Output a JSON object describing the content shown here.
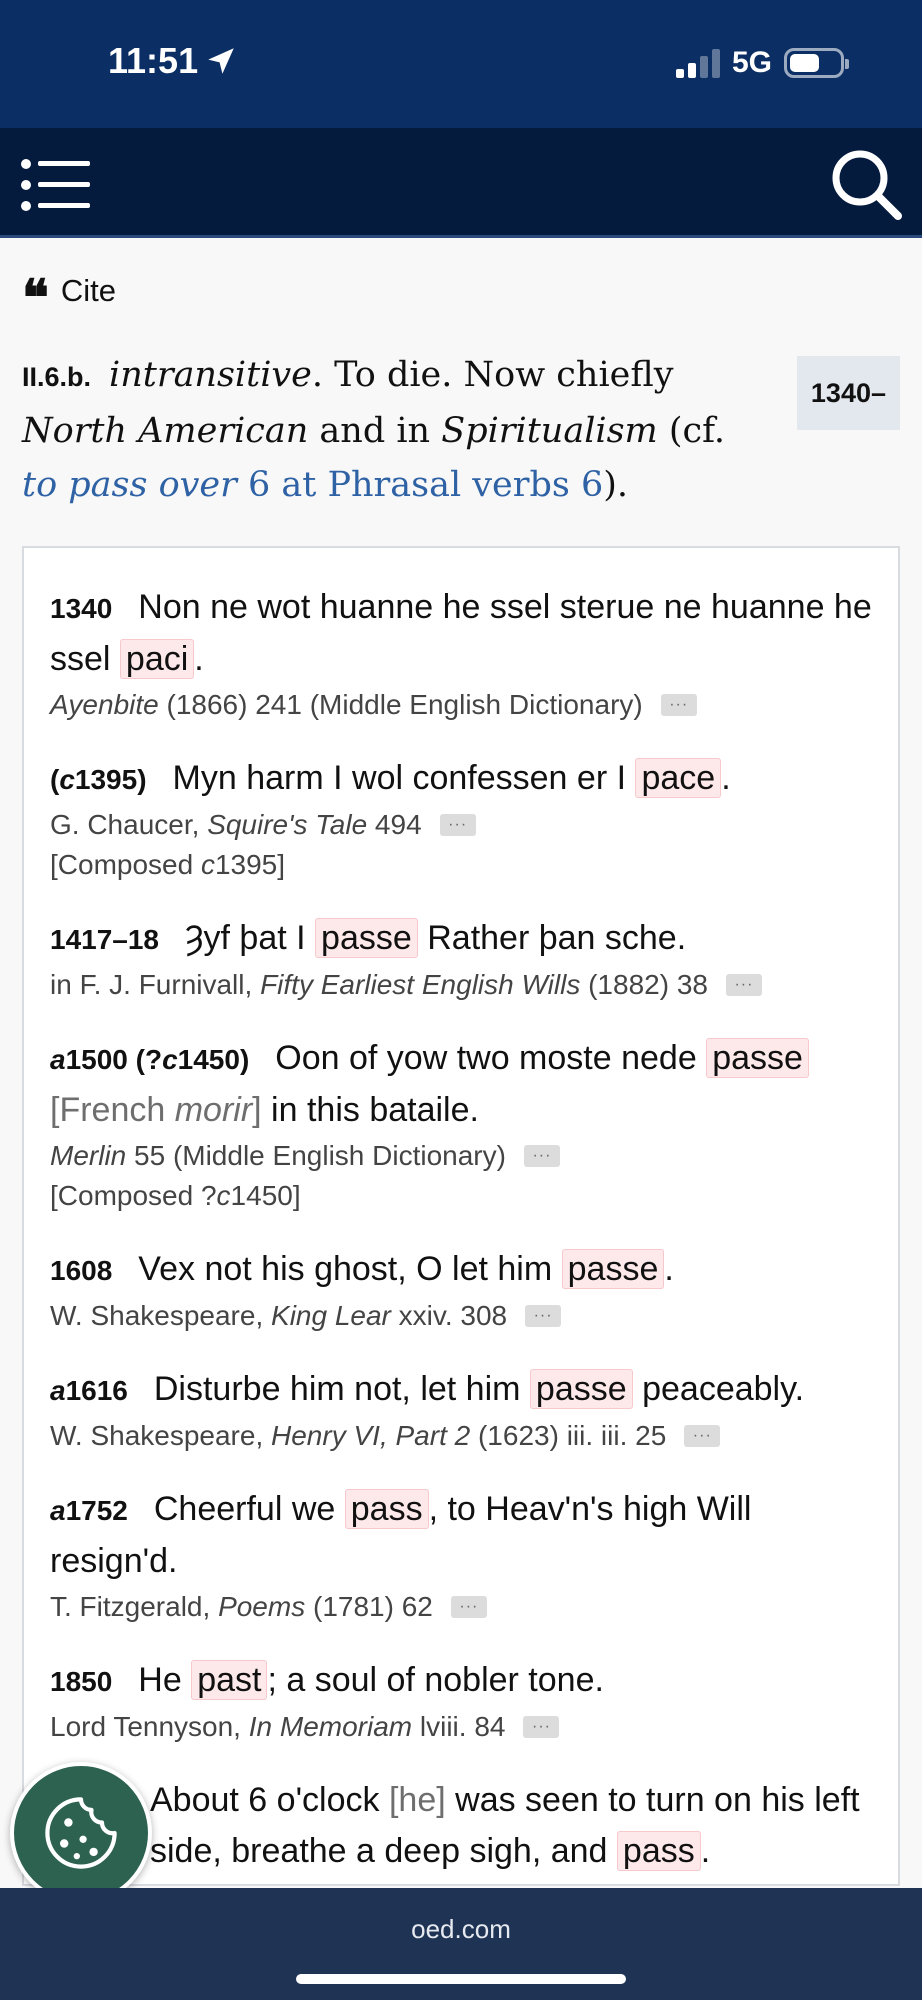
{
  "status_bar": {
    "time": "11:51",
    "network": "5G",
    "battery_level": 0.6
  },
  "header": {
    "menu_icon": "hamburger-menu-icon",
    "search_icon": "search-icon"
  },
  "cite": {
    "label": "Cite"
  },
  "sense": {
    "number": "II.6.b.",
    "p1": "intransitive",
    "p2": ". To die. Now chiefly",
    "p3": "North American",
    "p4": " and in ",
    "p5": "Spiritualism",
    "p6": " (cf. ",
    "link1": "to pass over",
    "link2": " 6 at Phrasal verbs 6",
    "p7": ").",
    "date_range": "1340–"
  },
  "quotations": [
    {
      "year": "1340",
      "pre": "Non ne wot huanne he ssel sterue ne huanne he ssel ",
      "hl": "paci",
      "post": ".",
      "src_italic": "Ayenbite",
      "src_after": " (1866) 241 (Middle English Dictionary)"
    },
    {
      "year_a": "(",
      "year_i": "c",
      "year_b": "1395)",
      "pre": "Myn harm I wol confessen er I ",
      "hl": "pace",
      "post": ".",
      "src_before": "G. Chaucer, ",
      "src_italic": "Squire's Tale",
      "src_after": " 494",
      "note_a": "[Composed ",
      "note_i": "c",
      "note_b": "1395]"
    },
    {
      "year": "1417–18",
      "pre": "Ȝyf þat I ",
      "hl": "passe",
      "post": " Rather þan sche.",
      "src_before": "in F. J. Furnivall, ",
      "src_italic": "Fifty Earliest English Wills",
      "src_after": " (1882) 38"
    },
    {
      "year_i": "a",
      "year_b": "1500 (?",
      "year_i2": "c",
      "year_c": "1450)",
      "pre": "Oon of yow two moste nede ",
      "hl": "passe",
      "br_a": "[French ",
      "br_i": "morir",
      "br_b": "]",
      "post": " in this bataile.",
      "src_italic": "Merlin",
      "src_after": " 55 (Middle English Dictionary)",
      "note_a": "[Composed ?",
      "note_i": "c",
      "note_b": "1450]"
    },
    {
      "year": "1608",
      "pre": "Vex not his ghost, O let him ",
      "hl": "passe",
      "post": ".",
      "src_before": "W. Shakespeare, ",
      "src_italic": "King Lear",
      "src_after": " xxiv. 308"
    },
    {
      "year_i": "a",
      "year_b": "1616",
      "pre": "Disturbe him not, let him ",
      "hl": "passe",
      "post": " peaceably.",
      "src_before": "W. Shakespeare, ",
      "src_italic": "Henry VI, Part 2",
      "src_after": " (1623) iii. iii. 25"
    },
    {
      "year_i": "a",
      "year_b": "1752",
      "pre": "Cheerful we ",
      "hl": "pass",
      "post": ", to Heav'n's high Will resign'd.",
      "src_before": "T. Fitzgerald, ",
      "src_italic": "Poems",
      "src_after": " (1781) 62"
    },
    {
      "year": "1850",
      "pre": "He ",
      "hl": "past",
      "post": "; a soul of nobler tone.",
      "src_before": "Lord Tennyson, ",
      "src_italic": "In Memoriam",
      "src_after": " lviii. 84"
    },
    {
      "pre": "About 6 o'clock ",
      "br": "[he]",
      "mid": " was seen to turn on his left side, breathe a deep sigh, and ",
      "hl": "pass",
      "post": "."
    }
  ],
  "more_label": "···",
  "url_bar": {
    "url": "oed.com"
  }
}
